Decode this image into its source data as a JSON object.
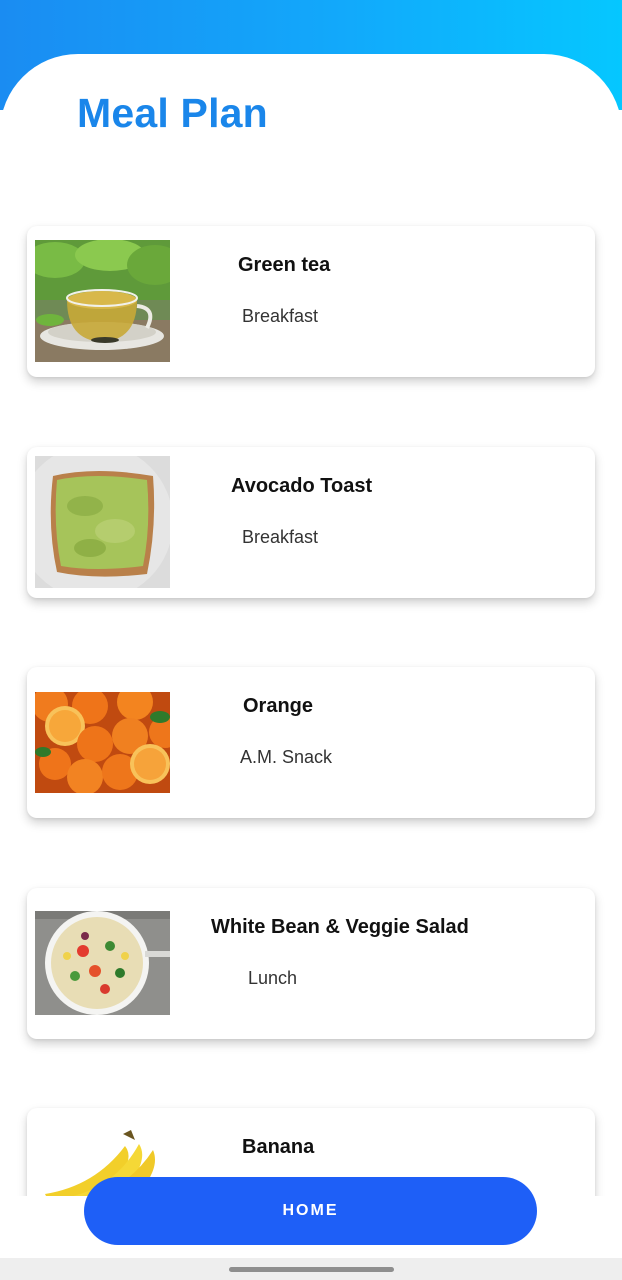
{
  "header": {
    "title": "Meal Plan",
    "gradient_colors": [
      "#1a8cf2",
      "#05c7ff"
    ],
    "title_color": "#1a86ea"
  },
  "meals": [
    {
      "name": "Green tea",
      "time": "Breakfast",
      "image": "green-tea-image"
    },
    {
      "name": "Avocado Toast",
      "time": "Breakfast",
      "image": "avocado-toast-image"
    },
    {
      "name": "Orange",
      "time": "A.M. Snack",
      "image": "orange-image"
    },
    {
      "name": "White Bean & Veggie Salad",
      "time": "Lunch",
      "image": "salad-image"
    },
    {
      "name": "Banana",
      "time": "",
      "image": "banana-image"
    }
  ],
  "footer": {
    "home_label": "HOME",
    "button_color": "#1e5ff7"
  }
}
